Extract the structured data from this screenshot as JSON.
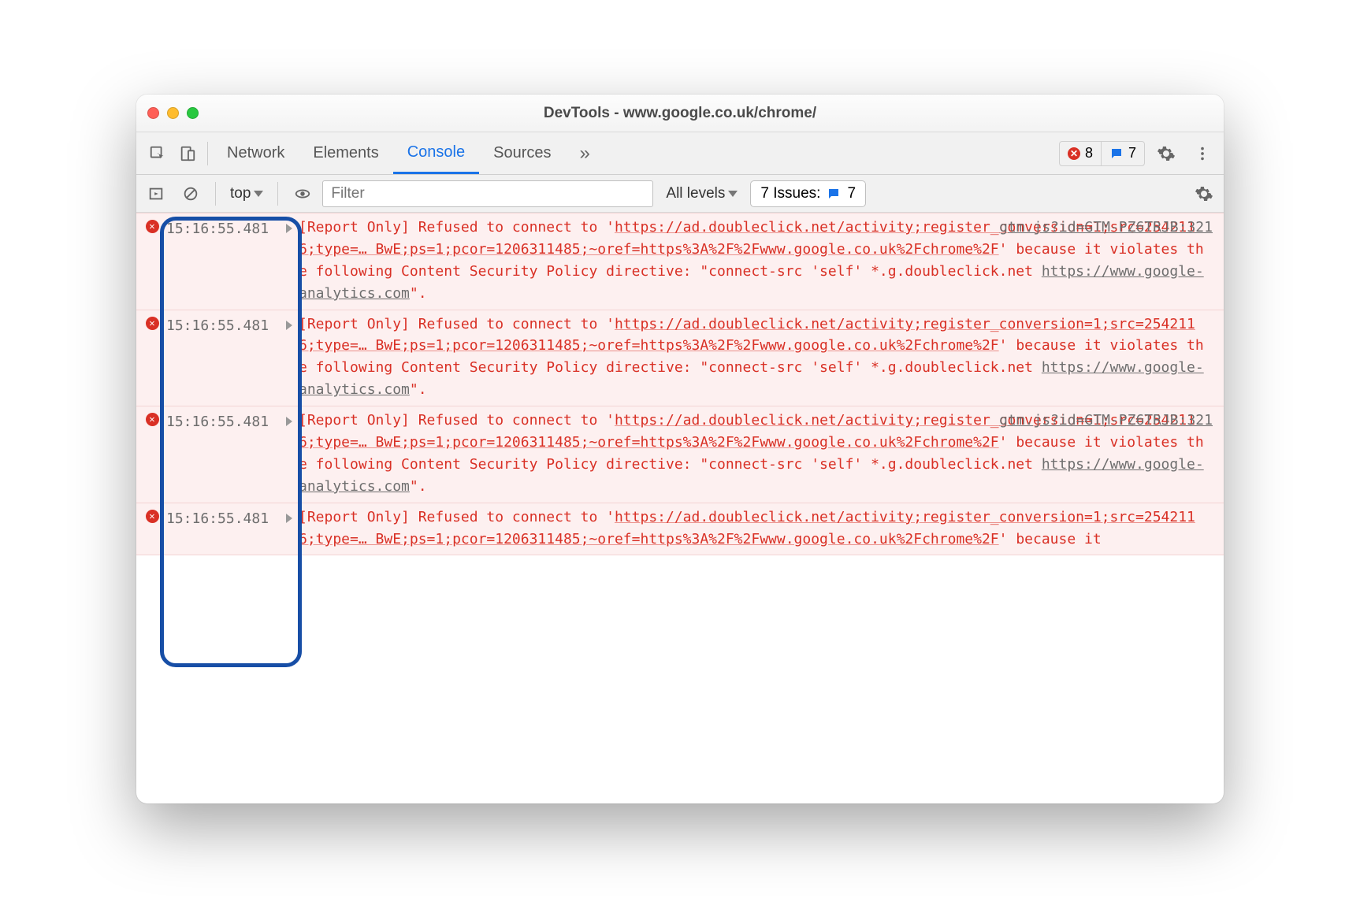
{
  "window": {
    "title": "DevTools - www.google.co.uk/chrome/"
  },
  "tabs": {
    "items": [
      "Network",
      "Elements",
      "Console",
      "Sources"
    ],
    "active": "Console",
    "more_glyph": "»"
  },
  "badges": {
    "errors": "8",
    "messages": "7"
  },
  "toolbar": {
    "context": "top",
    "filter_placeholder": "Filter",
    "level_label": "All levels",
    "issues_label": "7 Issues:",
    "issues_count": "7"
  },
  "logs": [
    {
      "timestamp": "15:16:55.481",
      "source": "gtm.js?id=GTM-PZ6TRJB:321",
      "prefix": "[Report Only] Refused to connect to '",
      "url_seg1": "http",
      "url_seg2": "s://ad.doubleclick.net/activity;register_conversion=1;src=2542116;type=… BwE;ps=1;pcor=1206311485;~oref=https%3A%2F%2Fwww.google.co.uk%2Fchrome%2F",
      "mid": "' because it violates the following Content Security Policy directive: \"connect-src 'self' *.g.doubleclick.net ",
      "policy_link": "https://www.google-analytics.com",
      "suffix": "\"."
    },
    {
      "timestamp": "15:16:55.481",
      "source": "",
      "prefix": "[Report Only] Refused to connect to '",
      "url_seg1": "https://ad.doubleclick.net/activity;register_conversion=1;src=2542116;type=… BwE;ps=1;pcor=1206311485;~oref=https%3A%2F%2Fwww.google.co.uk%2Fchrome%2F",
      "url_seg2": "",
      "mid": "' because it violates the following Content Security Policy directive: \"connect-src 'self' *.g.doubleclick.net ",
      "policy_link": "https://www.google-analytics.com",
      "suffix": "\"."
    },
    {
      "timestamp": "15:16:55.481",
      "source": "gtm.js?id=GTM-PZ6TRJB:321",
      "prefix": "[Report Only] Refused to connect to '",
      "url_seg1": "http",
      "url_seg2": "s://ad.doubleclick.net/activity;register_conversion=1;src=2542116;type=… BwE;ps=1;pcor=1206311485;~oref=https%3A%2F%2Fwww.google.co.uk%2Fchrome%2F",
      "mid": "' because it violates the following Content Security Policy directive: \"connect-src 'self' *.g.doubleclick.net ",
      "policy_link": "https://www.google-analytics.com",
      "suffix": "\"."
    },
    {
      "timestamp": "15:16:55.481",
      "source": "",
      "prefix": "[Report Only] Refused to connect to '",
      "url_seg1": "https://ad.doubleclick.net/activity;register_conversion=1;src=2542116;type=… BwE;ps=1;pcor=1206311485;~oref=https%3A%2F%2Fwww.google.co.uk%2Fchrome%2F",
      "url_seg2": "",
      "mid": "' because it",
      "policy_link": "",
      "suffix": ""
    }
  ],
  "annotation": {
    "highlight_area": "timestamps-column"
  }
}
